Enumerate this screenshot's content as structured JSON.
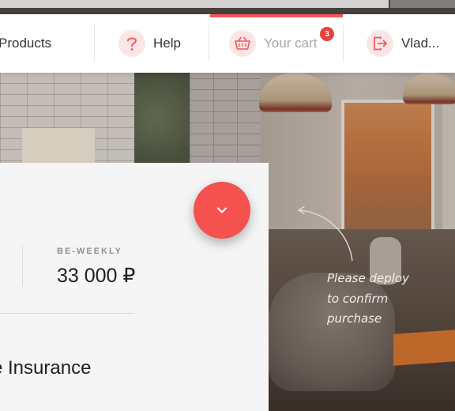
{
  "nav": {
    "products_label": "Products",
    "help_label": "Help",
    "cart_label": "Your cart",
    "cart_count": "3",
    "user_label": "Vlad...",
    "icons": {
      "help": "question-icon",
      "cart": "basket-icon",
      "user": "logout-icon"
    }
  },
  "card": {
    "frequency_label": "BE-WEEKLY",
    "amount": "33 000 ₽",
    "title": "e Insurance"
  },
  "hint": {
    "line1": "Please deploy",
    "line2": "to confirm",
    "line3": "purchase"
  },
  "colors": {
    "accent": "#f4514f",
    "badge": "#e8423f",
    "icon_bg": "#fbe6e6"
  }
}
